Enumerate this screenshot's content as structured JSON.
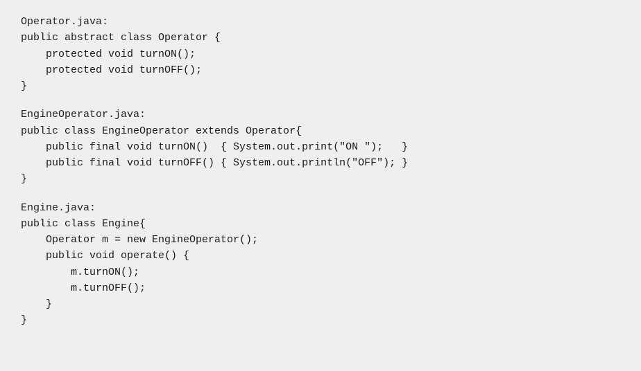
{
  "blocks": [
    {
      "id": "operator-block",
      "filename": "Operator.java:",
      "lines": [
        {
          "indent": 0,
          "text": "public abstract class Operator {"
        },
        {
          "indent": 1,
          "text": "protected void turnON();"
        },
        {
          "indent": 1,
          "text": "protected void turnOFF();"
        },
        {
          "indent": 0,
          "text": "}"
        }
      ]
    },
    {
      "id": "engineoperator-block",
      "filename": "EngineOperator.java:",
      "lines": [
        {
          "indent": 0,
          "text": "public class EngineOperator extends Operator{"
        },
        {
          "indent": 1,
          "text": "public final void turnON()  { System.out.print(\"ON \");   }"
        },
        {
          "indent": 1,
          "text": "public final void turnOFF() { System.out.println(\"OFF\"); }"
        },
        {
          "indent": 0,
          "text": "}"
        }
      ]
    },
    {
      "id": "engine-block",
      "filename": "Engine.java:",
      "lines": [
        {
          "indent": 0,
          "text": "public class Engine{"
        },
        {
          "indent": 1,
          "text": "Operator m = new EngineOperator();"
        },
        {
          "indent": 1,
          "text": "public void operate() {"
        },
        {
          "indent": 2,
          "text": "m.turnON();"
        },
        {
          "indent": 2,
          "text": "m.turnOFF();"
        },
        {
          "indent": 1,
          "text": "}"
        },
        {
          "indent": 0,
          "text": "}"
        }
      ]
    }
  ]
}
